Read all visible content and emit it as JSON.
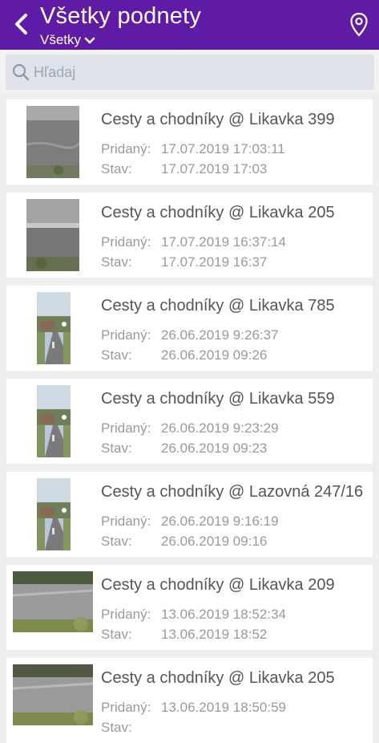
{
  "header": {
    "title": "Všetky podnety",
    "filter_label": "Všetky",
    "accent_color": "#5f1ba5"
  },
  "search": {
    "placeholder": "Hľadaj"
  },
  "labels": {
    "added": "Pridaný:",
    "status": "Stav:"
  },
  "items": [
    {
      "title": "Cesty a chodníky @ Likavka 399",
      "added": "17.07.2019 17:03:11",
      "status": "17.07.2019 17:03",
      "thumb": "road-gray"
    },
    {
      "title": "Cesty a chodníky @ Likavka 205",
      "added": "17.07.2019 16:37:14",
      "status": "17.07.2019 16:37",
      "thumb": "road-curb"
    },
    {
      "title": "Cesty a chodníky @ Likavka 785",
      "added": "26.06.2019 9:26:37",
      "status": "26.06.2019 09:26",
      "thumb": "street-portrait"
    },
    {
      "title": "Cesty a chodníky @ Likavka 559",
      "added": "26.06.2019 9:23:29",
      "status": "26.06.2019 09:23",
      "thumb": "street-portrait"
    },
    {
      "title": "Cesty a chodníky @ Lazovná 247/16",
      "added": "26.06.2019 9:16:19",
      "status": "26.06.2019 09:16",
      "thumb": "street-portrait"
    },
    {
      "title": "Cesty a chodníky @ Likavka 209",
      "added": "13.06.2019 18:52:34",
      "status": "13.06.2019 18:52",
      "thumb": "road-landscape"
    },
    {
      "title": "Cesty a chodníky @ Likavka 205",
      "added": "13.06.2019 18:50:59",
      "status": "",
      "thumb": "road-landscape"
    }
  ]
}
